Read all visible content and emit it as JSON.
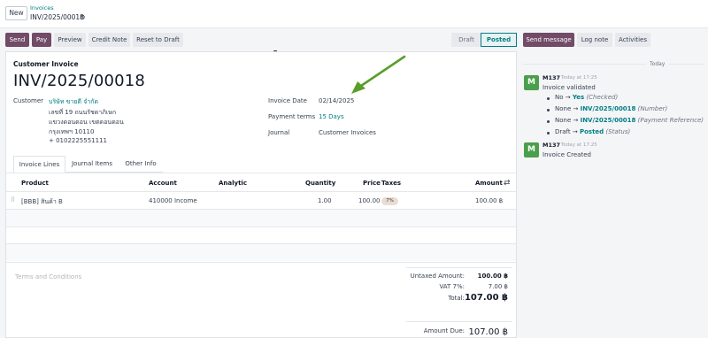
{
  "top": {
    "new_label": "New",
    "breadcrumb_parent": "Invoices",
    "record_name": "INV/2025/00018"
  },
  "actions": {
    "send": "Send",
    "pay": "Pay",
    "preview": "Preview",
    "credit_note": "Credit Note",
    "reset_to_draft": "Reset to Draft"
  },
  "statusbar": {
    "draft": "Draft",
    "posted": "Posted"
  },
  "invoice": {
    "type_label": "Customer Invoice",
    "number": "INV/2025/00018",
    "customer_label": "Customer",
    "customer_name": "บริษัท ขายดี จำกัด",
    "address_line1": "เลขที่ 19 ถนนรัชดาภิเษก",
    "address_line2": "แขวงดอนดอน เขตดอนดอน",
    "address_line3": "กรุงเทพฯ 10110",
    "phone": "+ 0102225551111",
    "date_label": "Invoice Date",
    "date_value": "02/14/2025",
    "terms_label": "Payment terms",
    "terms_value": "15 Days",
    "journal_label": "Journal",
    "journal_value": "Customer Invoices"
  },
  "tabs": [
    "Invoice Lines",
    "Journal Items",
    "Other Info"
  ],
  "lines": {
    "headers": {
      "product": "Product",
      "account": "Account",
      "analytic": "Analytic",
      "quantity": "Quantity",
      "price": "Price",
      "taxes": "Taxes",
      "amount": "Amount"
    },
    "rows": [
      {
        "product": "[BBB] สินค้า B",
        "account": "410000 Income",
        "quantity": "1.00",
        "price": "100.00",
        "tax": "7%",
        "amount": "100.00 ฿"
      }
    ]
  },
  "terms_placeholder": "Terms and Conditions",
  "totals": {
    "untaxed_label": "Untaxed Amount:",
    "untaxed_value": "100.00 ฿",
    "vat_label": "VAT 7%:",
    "vat_value": "7.00 ฿",
    "total_label": "Total:",
    "total_value": "107.00 ฿",
    "due_label": "Amount Due:",
    "due_value": "107.00 ฿"
  },
  "chatter": {
    "send_message": "Send message",
    "log_note": "Log note",
    "activities": "Activities",
    "day_label": "Today",
    "messages": [
      {
        "avatar": "M",
        "author": "M137",
        "time": "Today at 17:25",
        "body": "Invoice validated",
        "changes": [
          {
            "old": "No",
            "new": "Yes",
            "field": "(Checked)"
          },
          {
            "old": "None",
            "new": "INV/2025/00018",
            "field": "(Number)"
          },
          {
            "old": "None",
            "new": "INV/2025/00018",
            "field": "(Payment Reference)"
          },
          {
            "old": "Draft",
            "new": "Posted",
            "field": "(Status)"
          }
        ]
      },
      {
        "avatar": "M",
        "author": "M137",
        "time": "Today at 17:25",
        "body": "Invoice Created"
      }
    ]
  },
  "colors": {
    "primary": "#714b67",
    "link": "#017e84",
    "annotation_arrow": "#5a9e2a"
  }
}
